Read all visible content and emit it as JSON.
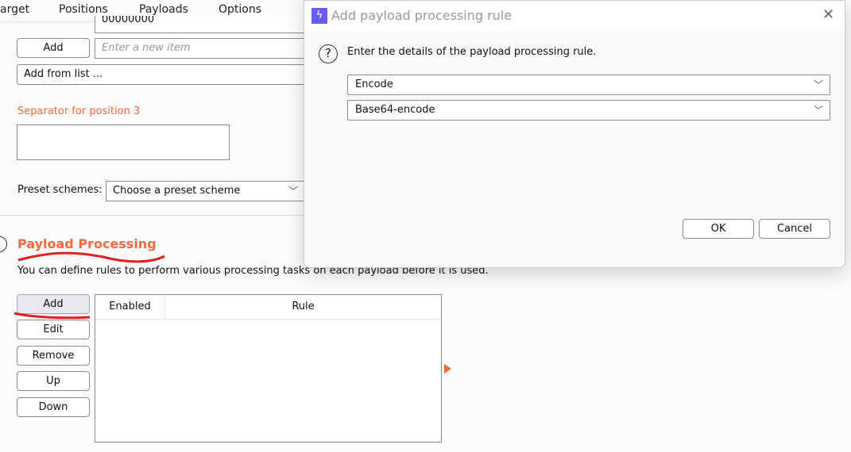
{
  "tabs": [
    {
      "label": "arget"
    },
    {
      "label": "Positions"
    },
    {
      "label": "Payloads"
    },
    {
      "label": "Options"
    }
  ],
  "active_tab": "Payloads",
  "list": {
    "partial_item": "00000000",
    "add_label": "Add",
    "new_item_placeholder": "Enter a new item",
    "add_from_list": "Add from list ..."
  },
  "separator": {
    "label": "Separator for position 3",
    "value": ""
  },
  "preset": {
    "label": "Preset schemes:",
    "value": "Choose a preset scheme"
  },
  "processing": {
    "title": "Payload Processing",
    "description": "You can define rules to perform various processing tasks on each payload before it is used.",
    "buttons": [
      "Add",
      "Edit",
      "Remove",
      "Up",
      "Down"
    ],
    "columns": [
      "Enabled",
      "Rule"
    ]
  },
  "dialog": {
    "title": "Add payload processing rule",
    "prompt": "Enter the details of the payload processing rule.",
    "type_value": "Encode",
    "subtype_value": "Base64-encode",
    "ok": "OK",
    "cancel": "Cancel"
  },
  "colors": {
    "accent": "#f26a3d",
    "annotation": "#e02020",
    "app_icon": "#6b5cf6"
  }
}
